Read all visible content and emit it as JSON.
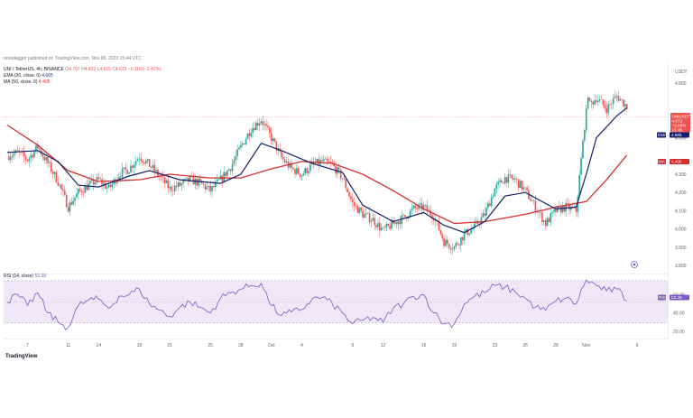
{
  "header": {
    "publisher": "renadagger published on TradingView.com, Nov 05, 2023 15:44 UTC",
    "symbol": "UNI / TetherUS, 4h, BINANCE",
    "ohlc_prefix_o": "O",
    "ohlc_o": "4.787",
    "ohlc_prefix_h": "H",
    "ohlc_h": "4.823",
    "ohlc_prefix_l": "L",
    "ohlc_l": "4.615",
    "ohlc_prefix_c": "C",
    "ohlc_c": "4.672",
    "ohlc_change": "−0.116 (−2.42%)",
    "ema_label": "EMA (20, close, 0)",
    "ema_value": "4.665",
    "ma_label": "MA (50, close, 0)",
    "ma_value": "4.405",
    "rsi_label": "RSI (14, close)",
    "rsi_value": "53.38"
  },
  "price_axis": {
    "currency": "USDT",
    "ticks": [
      "4.800",
      "4.700",
      "4.600",
      "4.500",
      "4.400",
      "4.300",
      "4.200",
      "4.100",
      "4.000",
      "3.900",
      "3.800"
    ]
  },
  "rsi_axis": {
    "ticks": [
      "60.00",
      "40.00",
      "20.00"
    ]
  },
  "tags": {
    "symbol_tag": "UNIUSDT",
    "price": "4.672",
    "change": "−5.86%",
    "countdown": "15:45",
    "ema_tag": "EMA",
    "ema_value": "4.665",
    "ma_tag": "MA",
    "ma_value": "4.405",
    "rsi_tag": "RSI",
    "rsi_value": "53.38"
  },
  "time_axis": [
    "7",
    "11",
    "14",
    "18",
    "21",
    "25",
    "28",
    "Oct",
    "4",
    "9",
    "12",
    "16",
    "19",
    "23",
    "26",
    "29",
    "Nov",
    "6"
  ],
  "watermark": "TradingView",
  "colors": {
    "up": "#26a69a",
    "down": "#ef5350",
    "ema": "#131f6b",
    "ma": "#d32f2f",
    "rsi": "#7e57c2",
    "rsi_band": "#ede7f6",
    "price_tag": "#ef5350"
  },
  "chart_data": {
    "type": "candlestick",
    "interval": "4h",
    "y_range": [
      3.77,
      4.85
    ],
    "x_range": [
      "Sep 5",
      "Nov 6"
    ],
    "anchors_close": [
      [
        "Sep 5",
        4.4
      ],
      [
        "Sep 6",
        4.42
      ],
      [
        "Sep 7",
        4.38
      ],
      [
        "Sep 8",
        4.45
      ],
      [
        "Sep 9",
        4.36
      ],
      [
        "Sep 10",
        4.26
      ],
      [
        "Sep 11",
        4.12
      ],
      [
        "Sep 12",
        4.2
      ],
      [
        "Sep 13",
        4.24
      ],
      [
        "Sep 14",
        4.27
      ],
      [
        "Sep 15",
        4.22
      ],
      [
        "Sep 16",
        4.3
      ],
      [
        "Sep 17",
        4.33
      ],
      [
        "Sep 18",
        4.4
      ],
      [
        "Sep 19",
        4.35
      ],
      [
        "Sep 20",
        4.29
      ],
      [
        "Sep 21",
        4.22
      ],
      [
        "Sep 22",
        4.24
      ],
      [
        "Sep 23",
        4.27
      ],
      [
        "Sep 24",
        4.25
      ],
      [
        "Sep 25",
        4.21
      ],
      [
        "Sep 26",
        4.27
      ],
      [
        "Sep 27",
        4.34
      ],
      [
        "Sep 28",
        4.45
      ],
      [
        "Sep 29",
        4.55
      ],
      [
        "Sep 30",
        4.6
      ],
      [
        "Oct 1",
        4.5
      ],
      [
        "Oct 2",
        4.39
      ],
      [
        "Oct 3",
        4.33
      ],
      [
        "Oct 4",
        4.3
      ],
      [
        "Oct 5",
        4.35
      ],
      [
        "Oct 6",
        4.37
      ],
      [
        "Oct 7",
        4.35
      ],
      [
        "Oct 8",
        4.28
      ],
      [
        "Oct 9",
        4.14
      ],
      [
        "Oct 10",
        4.08
      ],
      [
        "Oct 11",
        4.05
      ],
      [
        "Oct 12",
        3.99
      ],
      [
        "Oct 13",
        4.03
      ],
      [
        "Oct 14",
        4.06
      ],
      [
        "Oct 15",
        4.11
      ],
      [
        "Oct 16",
        4.12
      ],
      [
        "Oct 17",
        4.07
      ],
      [
        "Oct 18",
        3.93
      ],
      [
        "Oct 19",
        3.9
      ],
      [
        "Oct 20",
        3.97
      ],
      [
        "Oct 21",
        4.01
      ],
      [
        "Oct 22",
        4.08
      ],
      [
        "Oct 23",
        4.22
      ],
      [
        "Oct 24",
        4.28
      ],
      [
        "Oct 25",
        4.27
      ],
      [
        "Oct 26",
        4.21
      ],
      [
        "Oct 27",
        4.12
      ],
      [
        "Oct 28",
        4.03
      ],
      [
        "Oct 29",
        4.1
      ],
      [
        "Oct 30",
        4.12
      ],
      [
        "Oct 31",
        4.1
      ],
      [
        "Nov 1",
        4.66
      ],
      [
        "Nov 2",
        4.72
      ],
      [
        "Nov 3",
        4.66
      ],
      [
        "Nov 4",
        4.73
      ],
      [
        "Nov 5",
        4.672
      ]
    ],
    "ema_20": [
      [
        "Sep 5",
        4.42
      ],
      [
        "Sep 8",
        4.43
      ],
      [
        "Sep 10",
        4.37
      ],
      [
        "Sep 12",
        4.24
      ],
      [
        "Sep 14",
        4.23
      ],
      [
        "Sep 17",
        4.29
      ],
      [
        "Sep 19",
        4.32
      ],
      [
        "Sep 22",
        4.27
      ],
      [
        "Sep 26",
        4.25
      ],
      [
        "Sep 28",
        4.3
      ],
      [
        "Sep 30",
        4.47
      ],
      [
        "Oct 2",
        4.43
      ],
      [
        "Oct 5",
        4.36
      ],
      [
        "Oct 8",
        4.31
      ],
      [
        "Oct 10",
        4.13
      ],
      [
        "Oct 13",
        4.04
      ],
      [
        "Oct 16",
        4.09
      ],
      [
        "Oct 18",
        4.02
      ],
      [
        "Oct 20",
        3.98
      ],
      [
        "Oct 22",
        4.04
      ],
      [
        "Oct 24",
        4.18
      ],
      [
        "Oct 26",
        4.2
      ],
      [
        "Oct 29",
        4.11
      ],
      [
        "Oct 31",
        4.12
      ],
      [
        "Nov 1",
        4.3
      ],
      [
        "Nov 2",
        4.5
      ],
      [
        "Nov 4",
        4.62
      ],
      [
        "Nov 5",
        4.665
      ]
    ],
    "ma_50": [
      [
        "Sep 5",
        4.57
      ],
      [
        "Sep 8",
        4.46
      ],
      [
        "Sep 11",
        4.32
      ],
      [
        "Sep 14",
        4.26
      ],
      [
        "Sep 18",
        4.27
      ],
      [
        "Sep 21",
        4.3
      ],
      [
        "Sep 25",
        4.28
      ],
      [
        "Sep 28",
        4.28
      ],
      [
        "Oct 1",
        4.33
      ],
      [
        "Oct 4",
        4.37
      ],
      [
        "Oct 7",
        4.36
      ],
      [
        "Oct 10",
        4.3
      ],
      [
        "Oct 13",
        4.21
      ],
      [
        "Oct 16",
        4.11
      ],
      [
        "Oct 19",
        4.03
      ],
      [
        "Oct 22",
        4.04
      ],
      [
        "Oct 26",
        4.08
      ],
      [
        "Oct 29",
        4.12
      ],
      [
        "Nov 1",
        4.15
      ],
      [
        "Nov 3",
        4.27
      ],
      [
        "Nov 5",
        4.405
      ]
    ],
    "rsi_14": {
      "range": [
        15,
        80
      ],
      "bands": [
        30,
        70
      ],
      "points": [
        [
          "Sep 5",
          52
        ],
        [
          "Sep 6",
          60
        ],
        [
          "Sep 7",
          48
        ],
        [
          "Sep 8",
          62
        ],
        [
          "Sep 9",
          40
        ],
        [
          "Sep 10",
          30
        ],
        [
          "Sep 11",
          24
        ],
        [
          "Sep 12",
          48
        ],
        [
          "Sep 13",
          54
        ],
        [
          "Sep 14",
          55
        ],
        [
          "Sep 15",
          45
        ],
        [
          "Sep 16",
          58
        ],
        [
          "Sep 17",
          60
        ],
        [
          "Sep 18",
          66
        ],
        [
          "Sep 19",
          50
        ],
        [
          "Sep 20",
          43
        ],
        [
          "Sep 21",
          36
        ],
        [
          "Sep 22",
          46
        ],
        [
          "Sep 23",
          52
        ],
        [
          "Sep 24",
          46
        ],
        [
          "Sep 25",
          40
        ],
        [
          "Sep 26",
          56
        ],
        [
          "Sep 27",
          62
        ],
        [
          "Sep 28",
          66
        ],
        [
          "Sep 29",
          70
        ],
        [
          "Sep 30",
          72
        ],
        [
          "Oct 1",
          48
        ],
        [
          "Oct 2",
          37
        ],
        [
          "Oct 3",
          41
        ],
        [
          "Oct 4",
          44
        ],
        [
          "Oct 5",
          55
        ],
        [
          "Oct 6",
          57
        ],
        [
          "Oct 7",
          50
        ],
        [
          "Oct 8",
          40
        ],
        [
          "Oct 9",
          28
        ],
        [
          "Oct 10",
          32
        ],
        [
          "Oct 11",
          35
        ],
        [
          "Oct 12",
          30
        ],
        [
          "Oct 13",
          45
        ],
        [
          "Oct 14",
          50
        ],
        [
          "Oct 15",
          58
        ],
        [
          "Oct 16",
          60
        ],
        [
          "Oct 17",
          40
        ],
        [
          "Oct 18",
          28
        ],
        [
          "Oct 19",
          28
        ],
        [
          "Oct 20",
          50
        ],
        [
          "Oct 21",
          58
        ],
        [
          "Oct 22",
          62
        ],
        [
          "Oct 23",
          70
        ],
        [
          "Oct 24",
          68
        ],
        [
          "Oct 25",
          63
        ],
        [
          "Oct 26",
          56
        ],
        [
          "Oct 27",
          46
        ],
        [
          "Oct 28",
          43
        ],
        [
          "Oct 29",
          53
        ],
        [
          "Oct 30",
          56
        ],
        [
          "Oct 31",
          50
        ],
        [
          "Nov 1",
          76
        ],
        [
          "Nov 2",
          70
        ],
        [
          "Nov 3",
          64
        ],
        [
          "Nov 4",
          66
        ],
        [
          "Nov 5",
          53.38
        ]
      ]
    }
  }
}
